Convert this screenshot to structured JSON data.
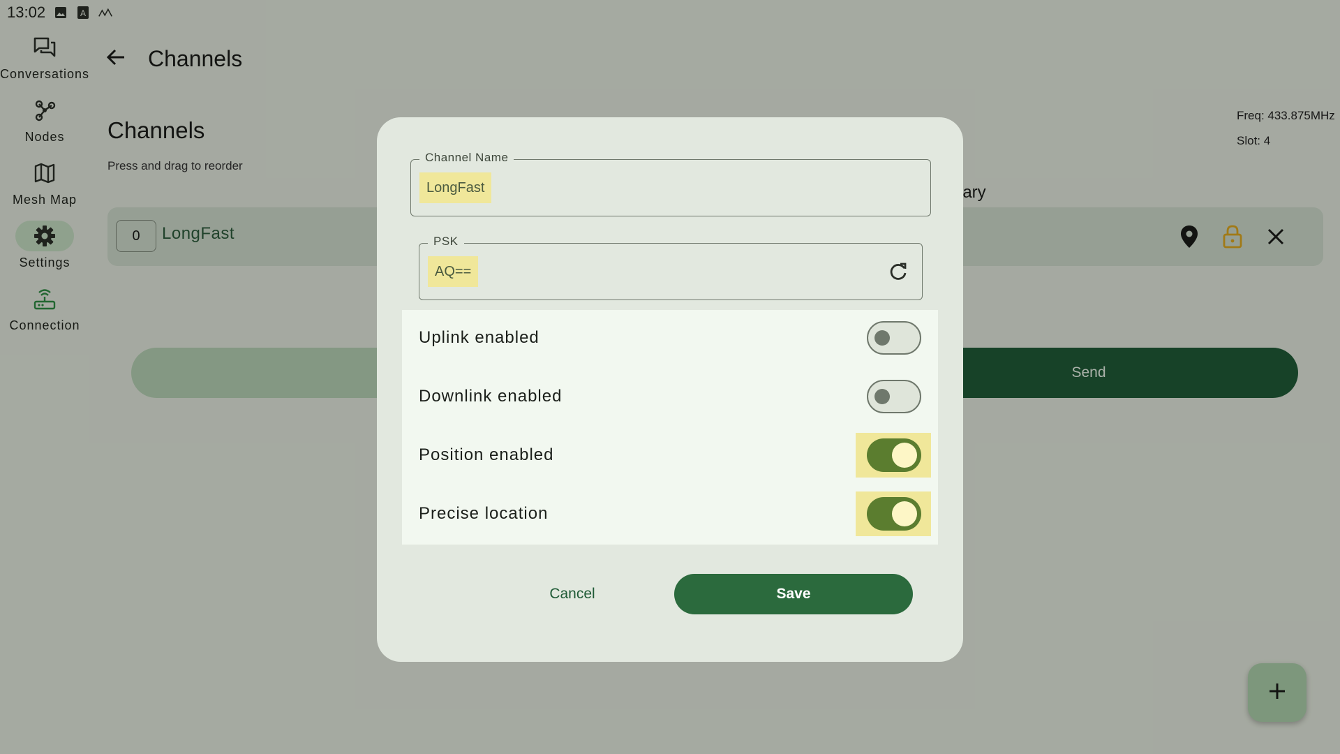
{
  "status_bar": {
    "time": "13:02",
    "icons": [
      "image-icon",
      "text-a-icon",
      "signal-wave-icon"
    ]
  },
  "nav_rail": {
    "items": [
      {
        "label": "Conversations",
        "icon": "conversations-icon",
        "active": false
      },
      {
        "label": "Nodes",
        "icon": "nodes-icon",
        "active": false
      },
      {
        "label": "Mesh Map",
        "icon": "map-icon",
        "active": false
      },
      {
        "label": "Settings",
        "icon": "gear-icon",
        "active": true
      },
      {
        "label": "Connection",
        "icon": "router-icon",
        "active": false
      }
    ]
  },
  "topbar": {
    "title": "Channels",
    "back_icon": "arrow-left-icon"
  },
  "content": {
    "section_title": "Channels",
    "subtitle": "Press and drag to reorder",
    "freq": "Freq: 433.875MHz",
    "slot": "Slot: 4",
    "secondary_label_partial": "lary",
    "channel_row": {
      "index": "0",
      "name": "LongFast"
    },
    "send_label": "Send"
  },
  "dialog": {
    "channel_name": {
      "label": "Channel Name",
      "value": "LongFast"
    },
    "psk": {
      "label": "PSK",
      "value": "AQ=="
    },
    "toggles": [
      {
        "label": "Uplink enabled",
        "on": false
      },
      {
        "label": "Downlink enabled",
        "on": false
      },
      {
        "label": "Position enabled",
        "on": true
      },
      {
        "label": "Precise location",
        "on": true
      }
    ],
    "cancel_label": "Cancel",
    "save_label": "Save"
  },
  "colors": {
    "primary": "#2b6a3d",
    "switch_on": "#5b7d2f",
    "highlight": "#f0e79a",
    "lock": "#d9a520"
  }
}
